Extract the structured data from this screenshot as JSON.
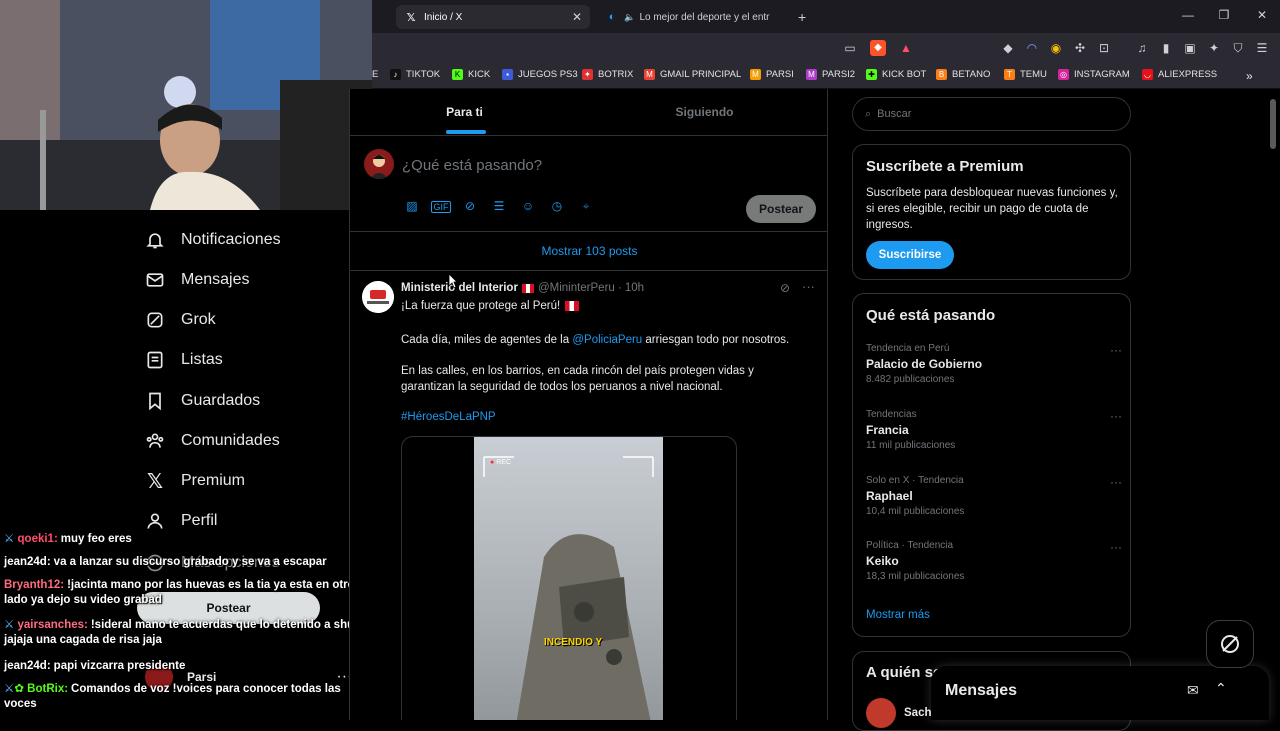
{
  "browser": {
    "tabs": [
      {
        "label": "Inicio / X",
        "active": true
      },
      {
        "label": "Lo mejor del deporte y el entreten"
      }
    ],
    "new_tab": "+",
    "bookmarks": [
      {
        "label": "E",
        "color": "#2b2a33"
      },
      {
        "label": "TIKTOK",
        "color": "#111111"
      },
      {
        "label": "KICK",
        "color": "#53fc18"
      },
      {
        "label": "JUEGOS PS3",
        "color": "#3b5bdb"
      },
      {
        "label": "BOTRIX",
        "color": "#e03131"
      },
      {
        "label": "GMAIL PRINCIPAL",
        "color": "#ea4335"
      },
      {
        "label": "PARSI",
        "color": "#f59f00"
      },
      {
        "label": "PARSI2",
        "color": "#ae3ec9"
      },
      {
        "label": "KICK BOT",
        "color": "#53fc18"
      },
      {
        "label": "BETANO",
        "color": "#fd7e14"
      },
      {
        "label": "TEMU",
        "color": "#fd7e14"
      },
      {
        "label": "INSTAGRAM",
        "color": "#d6249f"
      },
      {
        "label": "ALIEXPRESS",
        "color": "#e8111b"
      }
    ]
  },
  "sidebar": {
    "items": [
      {
        "label": "Notificaciones",
        "icon": "bell-icon"
      },
      {
        "label": "Mensajes",
        "icon": "mail-icon"
      },
      {
        "label": "Grok",
        "icon": "grok-icon"
      },
      {
        "label": "Listas",
        "icon": "list-icon"
      },
      {
        "label": "Guardados",
        "icon": "bookmark-icon"
      },
      {
        "label": "Comunidades",
        "icon": "communities-icon"
      },
      {
        "label": "Premium",
        "icon": "x-logo-icon"
      },
      {
        "label": "Perfil",
        "icon": "profile-icon"
      },
      {
        "label": "Más opciones",
        "icon": "more-icon"
      }
    ],
    "post_button": "Postear",
    "account_name": "Parsi"
  },
  "chat": [
    {
      "user": "qoeki1:",
      "color": "#ff4d6d",
      "badge": true,
      "text": "muy feo eres"
    },
    {
      "user": "jean24d:",
      "color": "#ffffff",
      "badge": false,
      "text": "va a lanzar su discurso grabado y se va a escapar"
    },
    {
      "user": "Bryanth12:",
      "color": "#ff6b81",
      "badge": false,
      "text": "!jacinta mano por las huevas es la tia ya esta en otro lado ya dejo su video grabad"
    },
    {
      "user": "yairsanches:",
      "color": "#ff6b81",
      "badge": true,
      "text": "!sideral mano te acuerdas que lo detenido a shuls jajaja una cagada de risa jaja"
    },
    {
      "user": "jean24d:",
      "color": "#ffffff",
      "badge": false,
      "text": "papi vizcarra presidente"
    },
    {
      "user": "BotRix:",
      "color": "#53fc18",
      "badge": true,
      "text": "Comandos de voz !voices para conocer todas las voces"
    }
  ],
  "timeline": {
    "tabs": [
      "Para ti",
      "Siguiendo"
    ],
    "compose_placeholder": "¿Qué está pasando?",
    "post_button": "Postear",
    "show_more": "Mostrar 103 posts",
    "post": {
      "author": "Ministerio del Interior",
      "handle": "@MininterPeru",
      "time": "· 10h",
      "line1": "¡La fuerza que protege al Perú!",
      "p2_pre": "Cada día, miles de agentes de la ",
      "p2_mention": "@PoliciaPeru",
      "p2_post": " arriesgan todo por nosotros.",
      "p3": "En las calles, en los barrios, en cada rincón del país protegen vidas y garantizan la seguridad de todos los peruanos a nivel nacional.",
      "hashtag": "#HéroesDeLaPNP",
      "video_rec": "REC",
      "video_caption": "INCENDIO Y"
    }
  },
  "right": {
    "search_placeholder": "Buscar",
    "premium": {
      "title": "Suscríbete a Premium",
      "body": "Suscríbete para desbloquear nuevas funciones y, si eres elegible, recibir un pago de cuota de ingresos.",
      "button": "Suscribirse"
    },
    "trending_title": "Qué está pasando",
    "trends": [
      {
        "meta": "Tendencia en Perú",
        "title": "Palacio de Gobierno",
        "count": "8.482 publicaciones"
      },
      {
        "meta": "Tendencias",
        "title": "Francia",
        "count": "11 mil publicaciones"
      },
      {
        "meta": "Solo en X · Tendencia",
        "title": "Raphael",
        "count": "10,4 mil publicaciones"
      },
      {
        "meta": "Política · Tendencia",
        "title": "Keiko",
        "count": "18,3 mil publicaciones"
      }
    ],
    "show_more": "Mostrar más",
    "who_to_follow": "A quién seguir",
    "follow_name": "Sacha",
    "messages": "Mensajes"
  }
}
